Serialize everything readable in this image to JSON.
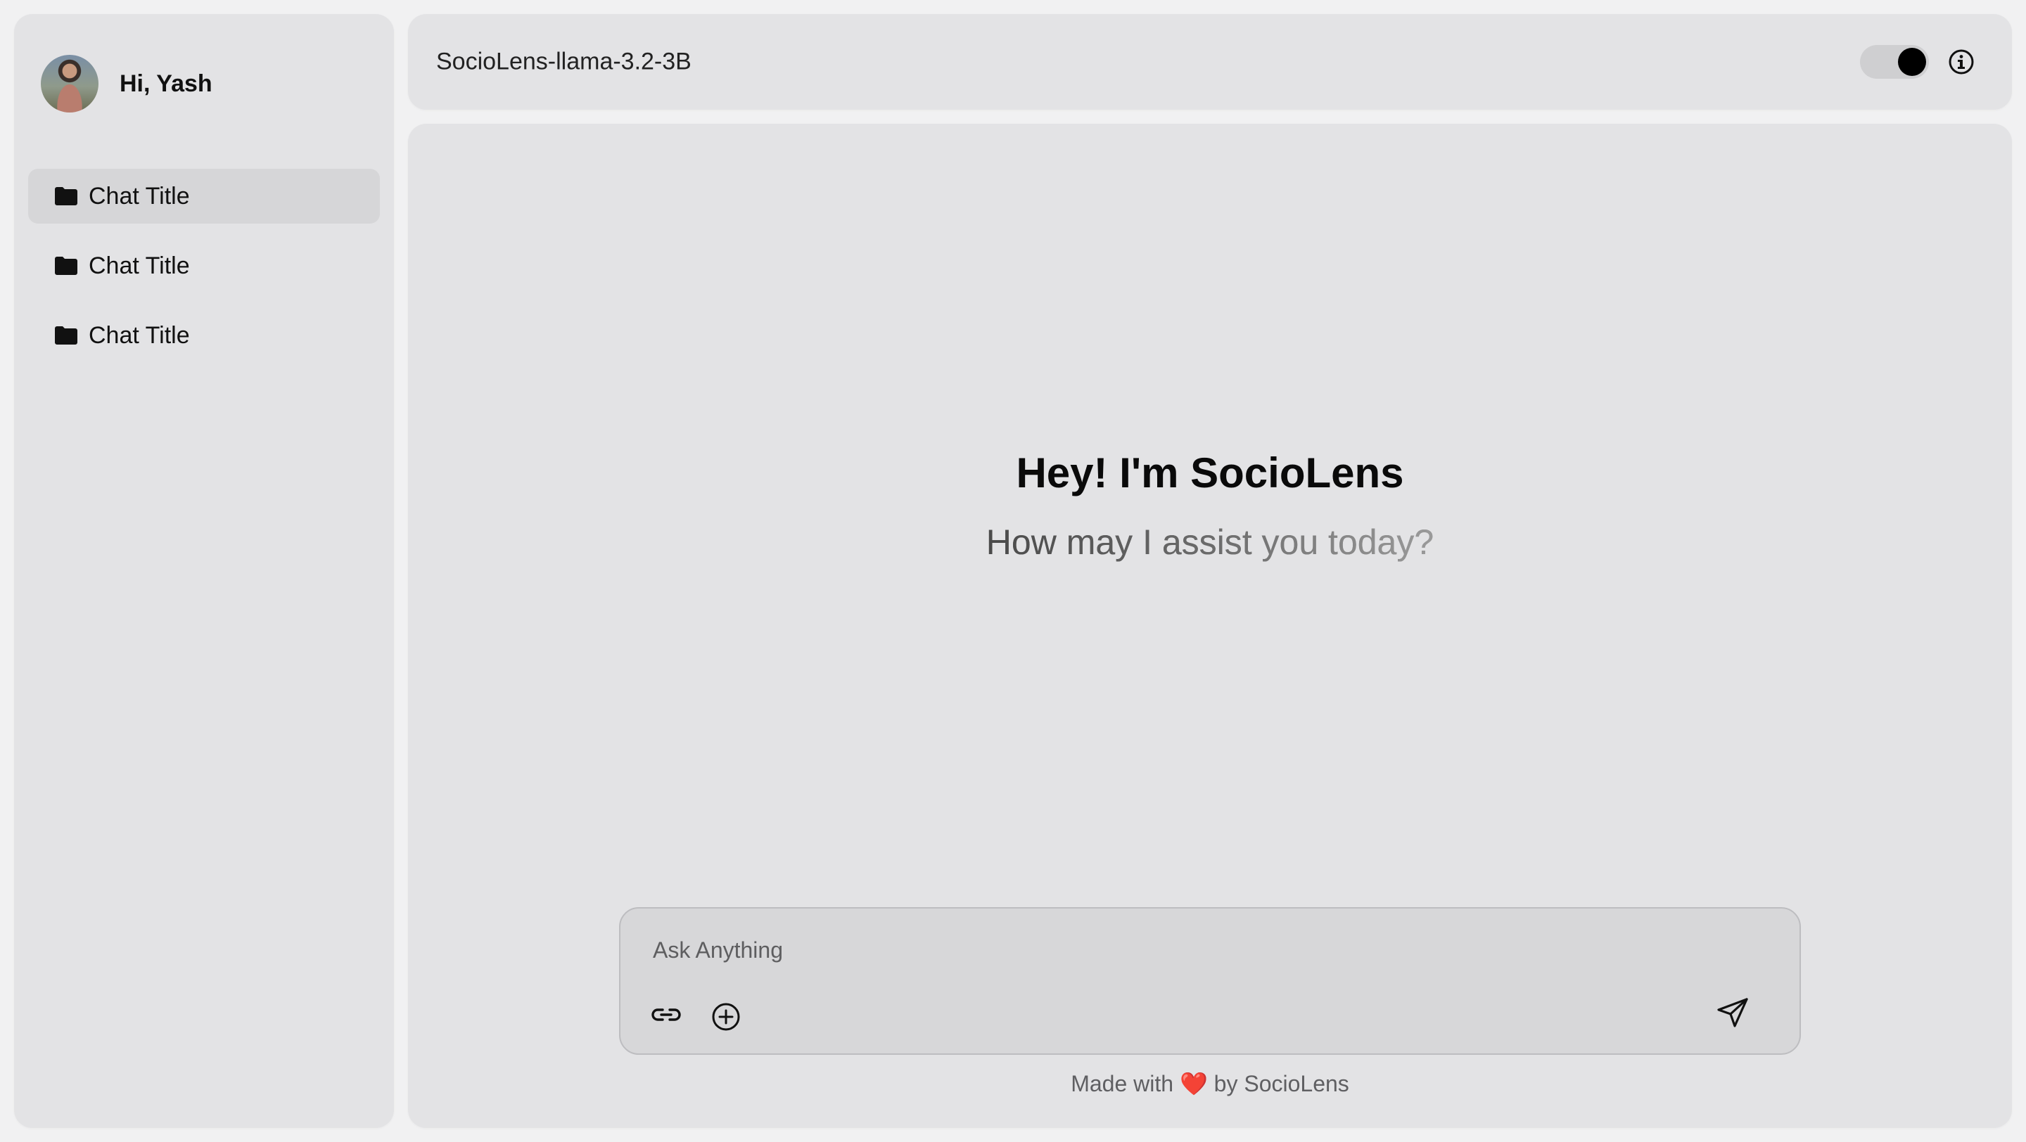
{
  "sidebar": {
    "greeting": "Hi, Yash",
    "chats": [
      {
        "label": "Chat Title",
        "active": true
      },
      {
        "label": "Chat Title",
        "active": false
      },
      {
        "label": "Chat Title",
        "active": false
      }
    ]
  },
  "header": {
    "model_name": "SocioLens-llama-3.2-3B",
    "theme_toggle_on": true
  },
  "main": {
    "hero_title": "Hey! I'm SocioLens",
    "hero_subtitle": "How may I assist you today?",
    "composer": {
      "placeholder": "Ask Anything",
      "value": ""
    },
    "footer": {
      "prefix": "Made with",
      "heart": "❤️",
      "suffix": "by SocioLens"
    }
  },
  "colors": {
    "background": "#f1f1f2",
    "panel": "#e3e3e5",
    "active_item": "#d6d6d8",
    "composer": "#d7d7d9",
    "toggle_knob": "#000000",
    "heart": "#d0202a"
  },
  "icons": {
    "folder": "folder-icon",
    "info": "info-icon",
    "link": "link-icon",
    "attach": "plus-circle-icon",
    "send": "send-icon"
  }
}
